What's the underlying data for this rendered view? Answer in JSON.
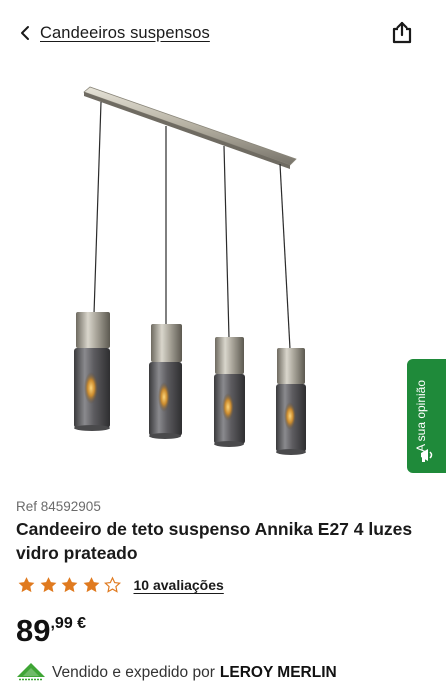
{
  "header": {
    "back_label": "Candeeiros suspensos",
    "back_icon": "chevron-left-icon",
    "share_icon": "share-icon"
  },
  "feedback_tab": {
    "label": "A sua opinião",
    "icon": "megaphone-icon",
    "color": "#1f8a3a"
  },
  "product": {
    "ref": "Ref 84592905",
    "title": "Candeeiro de teto suspenso Annika E27 4 luzes vidro prateado",
    "rating": {
      "value": 4,
      "max": 5,
      "reviews_label": "10 avaliações",
      "star_color": "#e07a1f"
    },
    "price": {
      "integer": "89",
      "decimal": ",99 €"
    },
    "seller": {
      "prefix": "Vendido e expedido por",
      "name": "LEROY MERLIN",
      "logo": "leroy-merlin-logo"
    }
  }
}
